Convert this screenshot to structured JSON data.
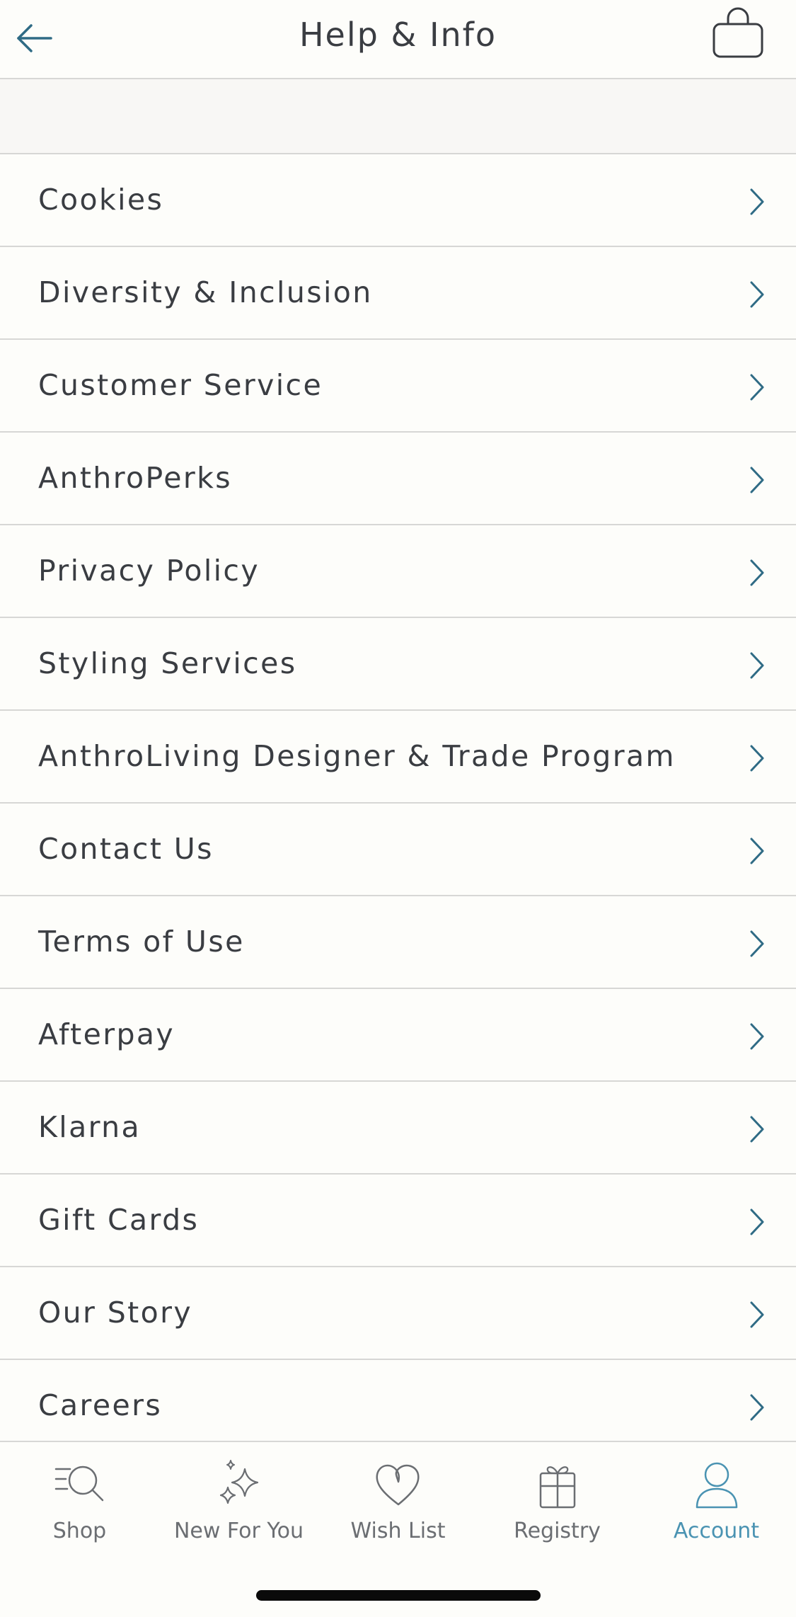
{
  "header": {
    "title": "Help & Info",
    "back_icon": "arrow-left-icon",
    "bag_icon": "shopping-bag-icon"
  },
  "menu": {
    "items": [
      {
        "label": "Cookies"
      },
      {
        "label": "Diversity & Inclusion"
      },
      {
        "label": "Customer Service"
      },
      {
        "label": "AnthroPerks"
      },
      {
        "label": "Privacy Policy"
      },
      {
        "label": "Styling Services"
      },
      {
        "label": "AnthroLiving Designer & Trade Program"
      },
      {
        "label": "Contact Us"
      },
      {
        "label": "Terms of Use"
      },
      {
        "label": "Afterpay"
      },
      {
        "label": "Klarna"
      },
      {
        "label": "Gift Cards"
      },
      {
        "label": "Our Story"
      },
      {
        "label": "Careers"
      }
    ]
  },
  "tabbar": {
    "tabs": [
      {
        "label": "Shop",
        "icon": "search-icon"
      },
      {
        "label": "New For You",
        "icon": "sparkle-icon"
      },
      {
        "label": "Wish List",
        "icon": "heart-icon"
      },
      {
        "label": "Registry",
        "icon": "gift-icon"
      },
      {
        "label": "Account",
        "icon": "user-icon",
        "active": true
      }
    ]
  },
  "colors": {
    "background": "#fdfdfa",
    "band": "#f8f7f5",
    "divider": "#d7d7d5",
    "text": "#3a3d42",
    "accent": "#2f6b85",
    "active_tab": "#4a93b2"
  }
}
